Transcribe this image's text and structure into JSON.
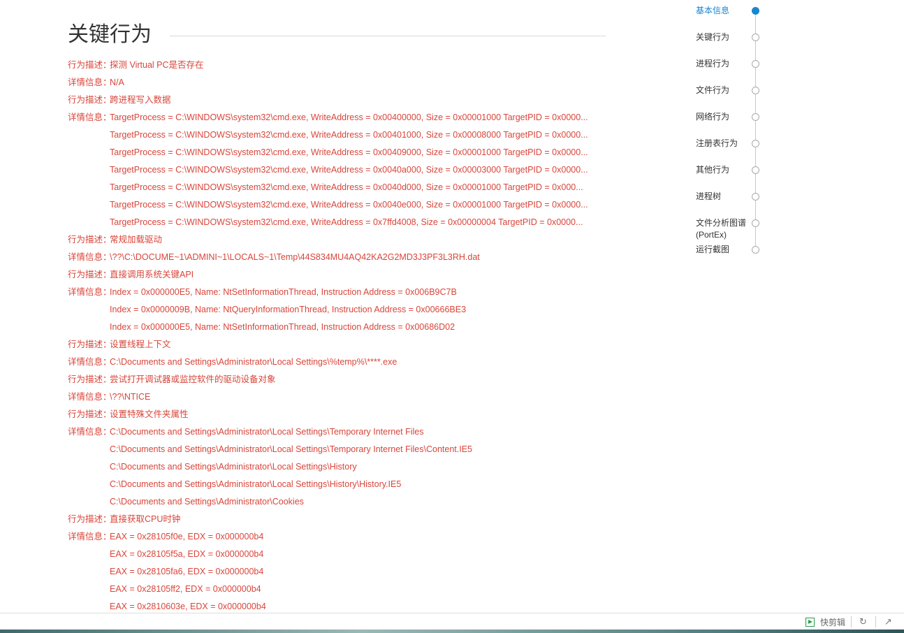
{
  "section": {
    "title": "关键行为"
  },
  "entries": [
    {
      "label": "行为描述：",
      "value": "探测 Virtual PC是否存在"
    },
    {
      "label": "详情信息：",
      "value": "N/A"
    },
    {
      "label": "行为描述：",
      "value": "跨进程写入数据"
    },
    {
      "label": "详情信息：",
      "value": "TargetProcess = C:\\WINDOWS\\system32\\cmd.exe, WriteAddress = 0x00400000, Size = 0x00001000 TargetPID = 0x0000..."
    },
    {
      "label": "",
      "value": "TargetProcess = C:\\WINDOWS\\system32\\cmd.exe, WriteAddress = 0x00401000, Size = 0x00008000 TargetPID = 0x0000..."
    },
    {
      "label": "",
      "value": "TargetProcess = C:\\WINDOWS\\system32\\cmd.exe, WriteAddress = 0x00409000, Size = 0x00001000 TargetPID = 0x0000..."
    },
    {
      "label": "",
      "value": "TargetProcess = C:\\WINDOWS\\system32\\cmd.exe, WriteAddress = 0x0040a000, Size = 0x00003000 TargetPID = 0x0000..."
    },
    {
      "label": "",
      "value": "TargetProcess = C:\\WINDOWS\\system32\\cmd.exe, WriteAddress = 0x0040d000, Size = 0x00001000 TargetPID = 0x000..."
    },
    {
      "label": "",
      "value": "TargetProcess = C:\\WINDOWS\\system32\\cmd.exe, WriteAddress = 0x0040e000, Size = 0x00001000 TargetPID = 0x0000..."
    },
    {
      "label": "",
      "value": "TargetProcess = C:\\WINDOWS\\system32\\cmd.exe, WriteAddress = 0x7ffd4008, Size = 0x00000004 TargetPID = 0x0000..."
    },
    {
      "label": "行为描述：",
      "value": "常规加载驱动"
    },
    {
      "label": "详情信息：",
      "value": "\\??\\C:\\DOCUME~1\\ADMINI~1\\LOCALS~1\\Temp\\44S834MU4AQ42KA2G2MD3J3PF3L3RH.dat"
    },
    {
      "label": "行为描述：",
      "value": "直接调用系统关键API"
    },
    {
      "label": "详情信息：",
      "value": "Index = 0x000000E5, Name: NtSetInformationThread, Instruction Address = 0x006B9C7B"
    },
    {
      "label": "",
      "value": "Index = 0x0000009B, Name: NtQueryInformationThread, Instruction Address = 0x00666BE3"
    },
    {
      "label": "",
      "value": "Index = 0x000000E5, Name: NtSetInformationThread, Instruction Address = 0x00686D02"
    },
    {
      "label": "行为描述：",
      "value": "设置线程上下文"
    },
    {
      "label": "详情信息：",
      "value": "C:\\Documents and Settings\\Administrator\\Local Settings\\%temp%\\****.exe"
    },
    {
      "label": "行为描述：",
      "value": "尝试打开调试器或监控软件的驱动设备对象"
    },
    {
      "label": "详情信息：",
      "value": "\\??\\NTICE"
    },
    {
      "label": "行为描述：",
      "value": "设置特殊文件夹属性"
    },
    {
      "label": "详情信息：",
      "value": "C:\\Documents and Settings\\Administrator\\Local Settings\\Temporary Internet Files"
    },
    {
      "label": "",
      "value": "C:\\Documents and Settings\\Administrator\\Local Settings\\Temporary Internet Files\\Content.IE5"
    },
    {
      "label": "",
      "value": "C:\\Documents and Settings\\Administrator\\Local Settings\\History"
    },
    {
      "label": "",
      "value": "C:\\Documents and Settings\\Administrator\\Local Settings\\History\\History.IE5"
    },
    {
      "label": "",
      "value": "C:\\Documents and Settings\\Administrator\\Cookies"
    },
    {
      "label": "行为描述：",
      "value": "直接获取CPU时钟"
    },
    {
      "label": "详情信息：",
      "value": "EAX = 0x28105f0e, EDX = 0x000000b4"
    },
    {
      "label": "",
      "value": "EAX = 0x28105f5a, EDX = 0x000000b4"
    },
    {
      "label": "",
      "value": "EAX = 0x28105fa6, EDX = 0x000000b4"
    },
    {
      "label": "",
      "value": "EAX = 0x28105ff2, EDX = 0x000000b4"
    },
    {
      "label": "",
      "value": "EAX = 0x2810603e, EDX = 0x000000b4"
    }
  ],
  "nav": {
    "active_color": "#1a86d0",
    "items": [
      {
        "label": "基本信息",
        "active": true
      },
      {
        "label": "关键行为",
        "active": false
      },
      {
        "label": "进程行为",
        "active": false
      },
      {
        "label": "文件行为",
        "active": false
      },
      {
        "label": "网络行为",
        "active": false
      },
      {
        "label": "注册表行为",
        "active": false
      },
      {
        "label": "其他行为",
        "active": false
      },
      {
        "label": "进程树",
        "active": false
      },
      {
        "label": "文件分析图谱(PortEx)",
        "active": false
      },
      {
        "label": "运行截图",
        "active": false
      }
    ]
  },
  "statusbar": {
    "snip_label": "快剪辑",
    "snip_icon": "play-icon",
    "refresh_icon": "refresh-icon",
    "pin_icon": "pin-icon",
    "accent": "#2a9a4a"
  }
}
